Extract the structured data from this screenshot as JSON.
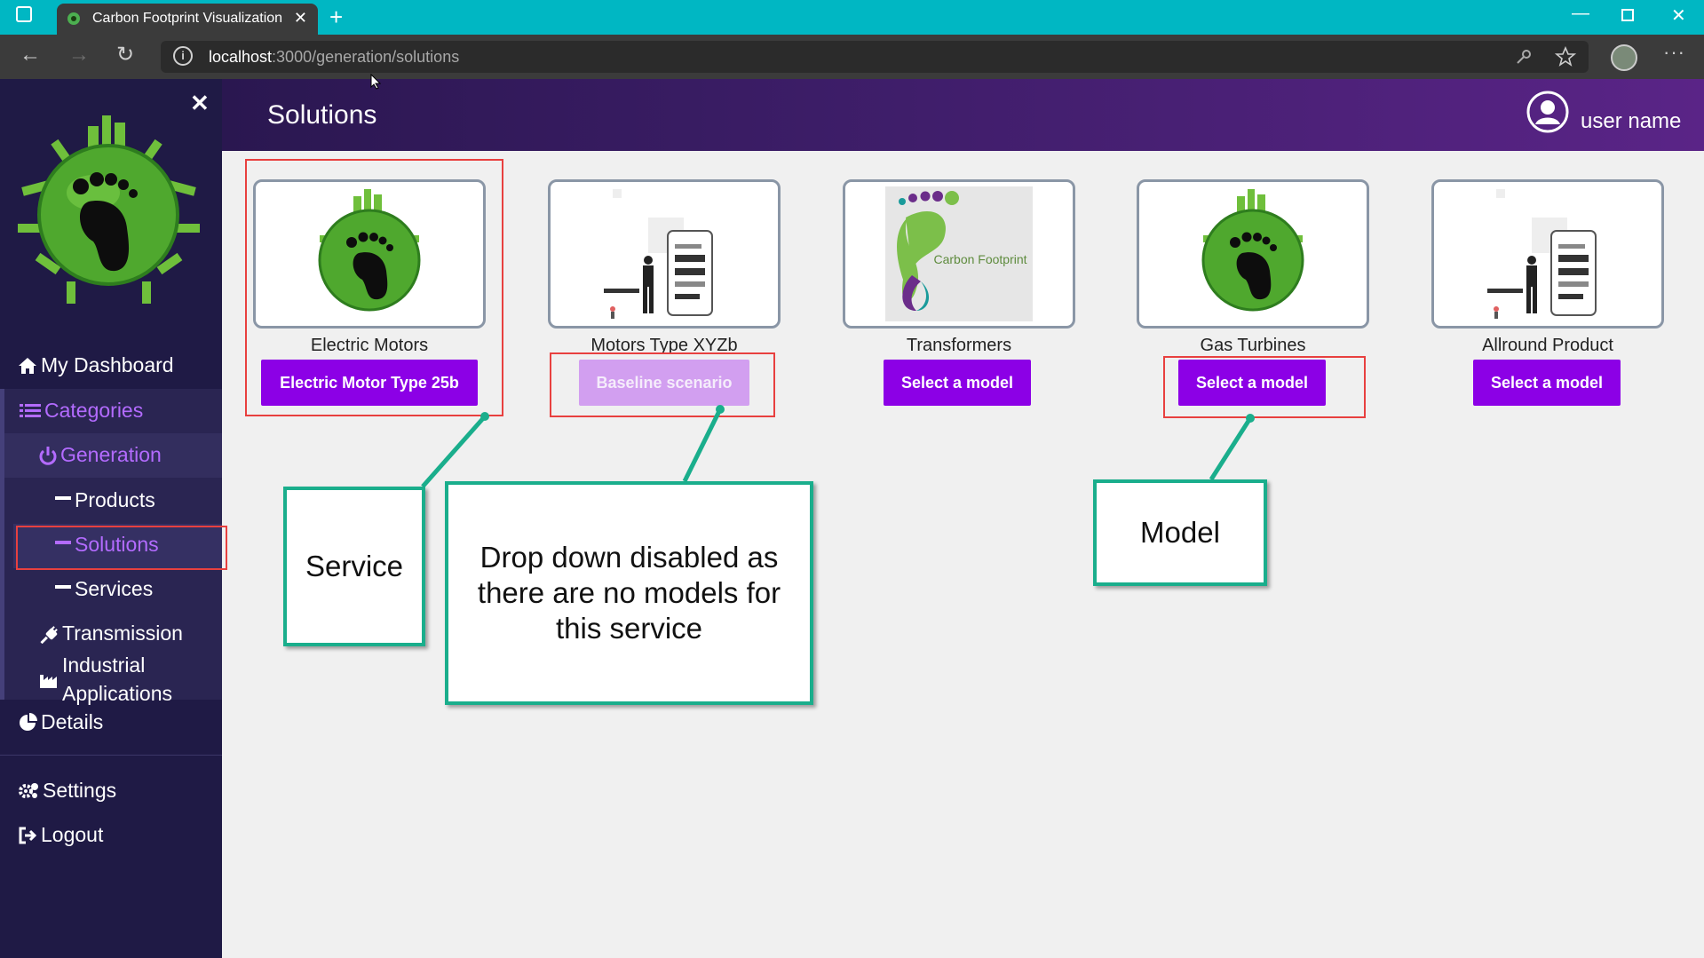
{
  "browser": {
    "tab_title": "Carbon Footprint Visualization",
    "url_host": "localhost",
    "url_path": ":3000/generation/solutions"
  },
  "header": {
    "page_title": "Solutions",
    "user_name": "user name"
  },
  "sidebar": {
    "items": {
      "dashboard": "My Dashboard",
      "categories": "Categories",
      "generation": "Generation",
      "products": "Products",
      "solutions": "Solutions",
      "services": "Services",
      "transmission": "Transmission",
      "industrial_line1": "Industrial",
      "industrial_line2": "Applications",
      "details": "Details",
      "settings": "Settings",
      "logout": "Logout"
    }
  },
  "cards": [
    {
      "label": "Electric Motors",
      "button": "Electric Motor Type 25b",
      "image": "earth-footprint",
      "disabled": false
    },
    {
      "label": "Motors Type XYZb",
      "button": "Baseline scenario",
      "image": "person-with-phone",
      "disabled": true
    },
    {
      "label": "Transformers",
      "button": "Select a model",
      "image": "carbon-footprint-logo",
      "image_text": "Carbon Footprint",
      "disabled": false
    },
    {
      "label": "Gas Turbines",
      "button": "Select a model",
      "image": "earth-footprint",
      "disabled": false
    },
    {
      "label": "Allround Product",
      "button": "Select a model",
      "image": "person-with-phone",
      "disabled": false
    }
  ],
  "annotations": {
    "service": "Service",
    "dropdown_line1": "Drop down disabled as",
    "dropdown_line2": "there are no models for",
    "dropdown_line3": "this service",
    "model": "Model"
  },
  "colors": {
    "accent": "#8c00e6",
    "accent_disabled": "#d29ff0",
    "sidebar_bg": "#1f1a45",
    "callout_border": "#1aae8c",
    "highlight_red": "#e8403f",
    "titlebar": "#00b7c3"
  }
}
